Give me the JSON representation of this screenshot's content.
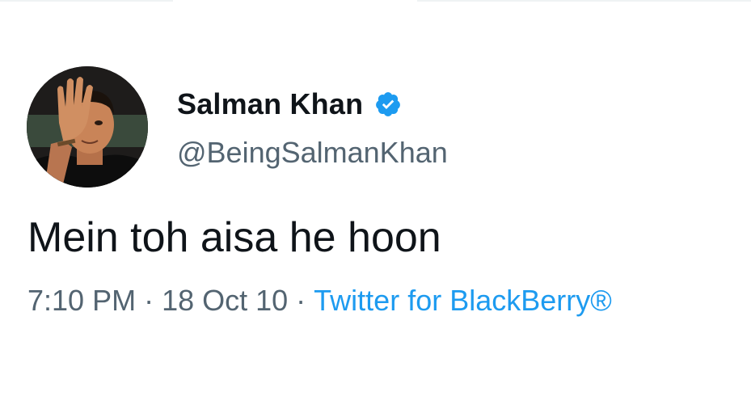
{
  "tweet": {
    "author": {
      "display_name": "Salman Khan",
      "handle": "@BeingSalmanKhan",
      "verified_icon": "verified-badge-icon",
      "verified_color": "#1d9bf0"
    },
    "text": "Mein toh aisa he hoon",
    "time": "7:10 PM",
    "date": "18 Oct 10",
    "separator": "·",
    "source": "Twitter for BlackBerry®"
  },
  "colors": {
    "text_primary": "#0f1419",
    "text_secondary": "#536471",
    "link": "#1d9bf0",
    "background": "#ffffff"
  }
}
